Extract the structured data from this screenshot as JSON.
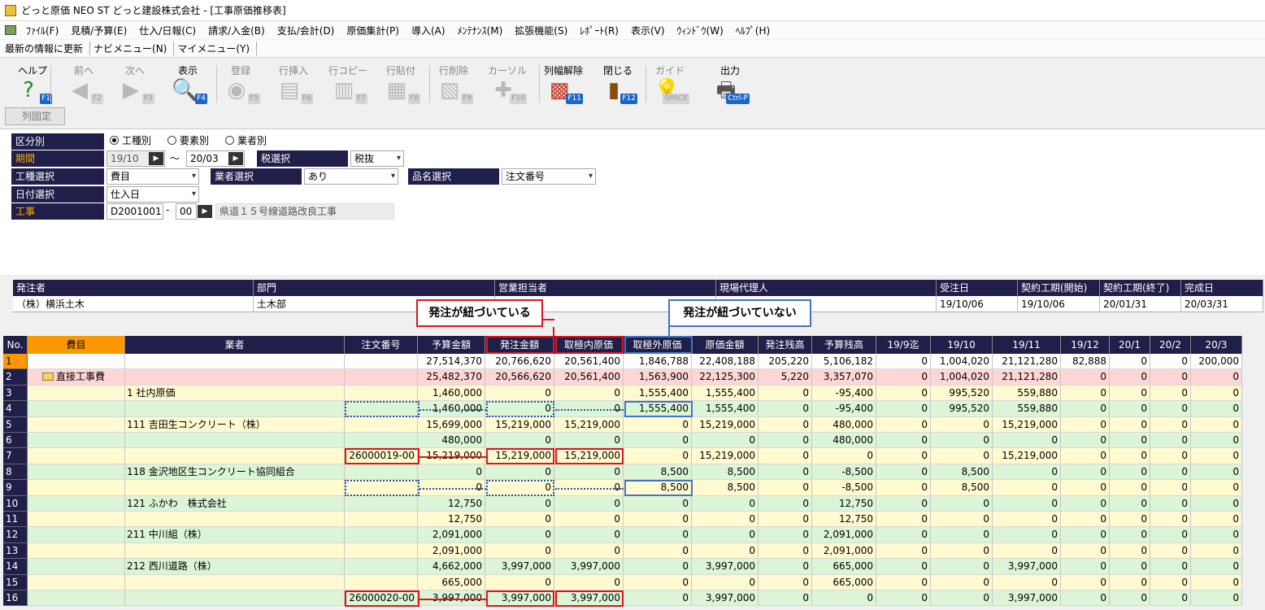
{
  "window": {
    "title": "どっと原価 NEO ST どっと建設株式会社 - [工事原価推移表]"
  },
  "menu": [
    "ﾌｧｲﾙ(F)",
    "見積/予算(E)",
    "仕入/日報(C)",
    "請求/入金(B)",
    "支払/会計(D)",
    "原価集計(P)",
    "導入(A)",
    "ﾒﾝﾃﾅﾝｽ(M)",
    "拡張機能(S)",
    "ﾚﾎﾟｰﾄ(R)",
    "表示(V)",
    "ｳｨﾝﾄﾞｳ(W)",
    "ﾍﾙﾌﾟ(H)"
  ],
  "nav": [
    "最新の情報に更新",
    "ナビメニュー(N)",
    "マイメニュー(Y)"
  ],
  "toolbar": [
    {
      "label": "ヘルプ",
      "key": "F1",
      "icon": "help-icon",
      "glyph": "?",
      "enabled": true
    },
    {
      "label": "前へ",
      "key": "F2",
      "icon": "back-arrow-icon",
      "glyph": "◀",
      "enabled": false
    },
    {
      "label": "次へ",
      "key": "F3",
      "icon": "forward-arrow-icon",
      "glyph": "▶",
      "enabled": false
    },
    {
      "label": "表示",
      "key": "F4",
      "icon": "magnifier-icon",
      "glyph": "🔍",
      "enabled": true
    },
    {
      "label": "登録",
      "key": "F5",
      "icon": "ok-icon",
      "glyph": "◉",
      "enabled": false
    },
    {
      "label": "行挿入",
      "key": "F6",
      "icon": "row-insert-icon",
      "glyph": "▤",
      "enabled": false
    },
    {
      "label": "行コピー",
      "key": "F7",
      "icon": "row-copy-icon",
      "glyph": "▥",
      "enabled": false
    },
    {
      "label": "行貼付",
      "key": "F8",
      "icon": "row-paste-icon",
      "glyph": "▦",
      "enabled": false
    },
    {
      "label": "行削除",
      "key": "F9",
      "icon": "row-delete-icon",
      "glyph": "▧",
      "enabled": false
    },
    {
      "label": "カーソル",
      "key": "F10",
      "icon": "cursor-icon",
      "glyph": "✚",
      "enabled": false
    },
    {
      "label": "列幅解除",
      "key": "F11",
      "icon": "column-width-icon",
      "glyph": "▩",
      "enabled": true
    },
    {
      "label": "閉じる",
      "key": "F12",
      "icon": "door-icon",
      "glyph": "▮",
      "enabled": true
    },
    {
      "label": "ガイド",
      "key": "SPACE",
      "icon": "lightbulb-icon",
      "glyph": "💡",
      "enabled": false
    },
    {
      "label": "出力",
      "key": "Ctrl-P",
      "icon": "printer-icon",
      "glyph": "🖶",
      "enabled": true
    }
  ],
  "fix_columns": "列固定",
  "form": {
    "kubun_label": "区分別",
    "radios": [
      {
        "label": "工種別",
        "selected": true
      },
      {
        "label": "要素別",
        "selected": false
      },
      {
        "label": "業者別",
        "selected": false
      }
    ],
    "period_label": "期間",
    "period_from": "19/10",
    "period_sep": "～",
    "period_to": "20/03",
    "tax_label": "税選択",
    "tax_value": "税抜",
    "kind_label": "工種選択",
    "kind_value": "費目",
    "vendor_label": "業者選択",
    "vendor_value": "あり",
    "item_label": "品名選択",
    "item_value": "注文番号",
    "date_label": "日付選択",
    "date_value": "仕入日",
    "project_label": "工事",
    "project_code": "D2001001",
    "project_dash": "-",
    "project_sub": "00",
    "project_name": "県道１５号線道路改良工事"
  },
  "info": {
    "headers": [
      "発注者",
      "部門",
      "営業担当者",
      "現場代理人",
      "受注日",
      "契約工期(開始)",
      "契約工期(終了)",
      "完成日"
    ],
    "values": [
      "（株）横浜土木",
      "土木部",
      "部",
      "",
      "19/10/06",
      "19/10/06",
      "20/01/31",
      "20/03/31"
    ]
  },
  "callouts": {
    "linked": "発注が紐づいている",
    "unlinked": "発注が紐づいていない"
  },
  "grid": {
    "headers": [
      "No.",
      "費目",
      "業者",
      "注文番号",
      "予算金額",
      "発注金額",
      "取極内原価",
      "取極外原価",
      "原価金額",
      "発注残高",
      "予算残高",
      "19/9迄",
      "19/10",
      "19/11",
      "19/12",
      "20/1",
      "20/2",
      "20/3"
    ],
    "rows": [
      [
        "1",
        "",
        "",
        "",
        "27,514,370",
        "20,766,620",
        "20,561,400",
        "1,846,788",
        "22,408,188",
        "205,220",
        "5,106,182",
        "0",
        "1,004,020",
        "21,121,280",
        "82,888",
        "0",
        "0",
        "200,000"
      ],
      [
        "2",
        "直接工事費",
        "",
        "",
        "25,482,370",
        "20,566,620",
        "20,561,400",
        "1,563,900",
        "22,125,300",
        "5,220",
        "3,357,070",
        "0",
        "1,004,020",
        "21,121,280",
        "0",
        "0",
        "0",
        "0"
      ],
      [
        "3",
        "",
        "1 社内原価",
        "",
        "1,460,000",
        "0",
        "0",
        "1,555,400",
        "1,555,400",
        "0",
        "-95,400",
        "0",
        "995,520",
        "559,880",
        "0",
        "0",
        "0",
        "0"
      ],
      [
        "4",
        "",
        "",
        "",
        "1,460,000",
        "0",
        "0",
        "1,555,400",
        "1,555,400",
        "0",
        "-95,400",
        "0",
        "995,520",
        "559,880",
        "0",
        "0",
        "0",
        "0"
      ],
      [
        "5",
        "",
        "111 吉田生コンクリート（株）",
        "",
        "15,699,000",
        "15,219,000",
        "15,219,000",
        "0",
        "15,219,000",
        "0",
        "480,000",
        "0",
        "0",
        "15,219,000",
        "0",
        "0",
        "0",
        "0"
      ],
      [
        "6",
        "",
        "",
        "",
        "480,000",
        "0",
        "0",
        "0",
        "0",
        "0",
        "480,000",
        "0",
        "0",
        "0",
        "0",
        "0",
        "0",
        "0"
      ],
      [
        "7",
        "",
        "",
        "26000019-00",
        "15,219,000",
        "15,219,000",
        "15,219,000",
        "0",
        "15,219,000",
        "0",
        "0",
        "0",
        "0",
        "15,219,000",
        "0",
        "0",
        "0",
        "0"
      ],
      [
        "8",
        "",
        "118 金沢地区生コンクリート協同組合",
        "",
        "0",
        "0",
        "0",
        "8,500",
        "8,500",
        "0",
        "-8,500",
        "0",
        "8,500",
        "0",
        "0",
        "0",
        "0",
        "0"
      ],
      [
        "9",
        "",
        "",
        "",
        "0",
        "0",
        "0",
        "8,500",
        "8,500",
        "0",
        "-8,500",
        "0",
        "8,500",
        "0",
        "0",
        "0",
        "0",
        "0"
      ],
      [
        "10",
        "",
        "121 ふかわ　株式会社",
        "",
        "12,750",
        "0",
        "0",
        "0",
        "0",
        "0",
        "12,750",
        "0",
        "0",
        "0",
        "0",
        "0",
        "0",
        "0"
      ],
      [
        "11",
        "",
        "",
        "",
        "12,750",
        "0",
        "0",
        "0",
        "0",
        "0",
        "12,750",
        "0",
        "0",
        "0",
        "0",
        "0",
        "0",
        "0"
      ],
      [
        "12",
        "",
        "211 中川組（株）",
        "",
        "2,091,000",
        "0",
        "0",
        "0",
        "0",
        "0",
        "2,091,000",
        "0",
        "0",
        "0",
        "0",
        "0",
        "0",
        "0"
      ],
      [
        "13",
        "",
        "",
        "",
        "2,091,000",
        "0",
        "0",
        "0",
        "0",
        "0",
        "2,091,000",
        "0",
        "0",
        "0",
        "0",
        "0",
        "0",
        "0"
      ],
      [
        "14",
        "",
        "212 西川道路（株）",
        "",
        "4,662,000",
        "3,997,000",
        "3,997,000",
        "0",
        "3,997,000",
        "0",
        "665,000",
        "0",
        "0",
        "3,997,000",
        "0",
        "0",
        "0",
        "0"
      ],
      [
        "15",
        "",
        "",
        "",
        "665,000",
        "0",
        "0",
        "0",
        "0",
        "0",
        "665,000",
        "0",
        "0",
        "0",
        "0",
        "0",
        "0",
        "0"
      ],
      [
        "16",
        "",
        "",
        "26000020-00",
        "3,997,000",
        "3,997,000",
        "3,997,000",
        "0",
        "3,997,000",
        "0",
        "0",
        "0",
        "0",
        "3,997,000",
        "0",
        "0",
        "0",
        "0"
      ]
    ]
  },
  "colors": {
    "header_bg": "#1f1f4a",
    "row_total": "#ffffff",
    "row_pink": "#ffd6d6",
    "row_yellow": "#fffad0",
    "row_green": "#dcf5d6",
    "accent_orange": "#ff9800",
    "callout_red": "#e0141e",
    "callout_blue": "#4472c4"
  }
}
